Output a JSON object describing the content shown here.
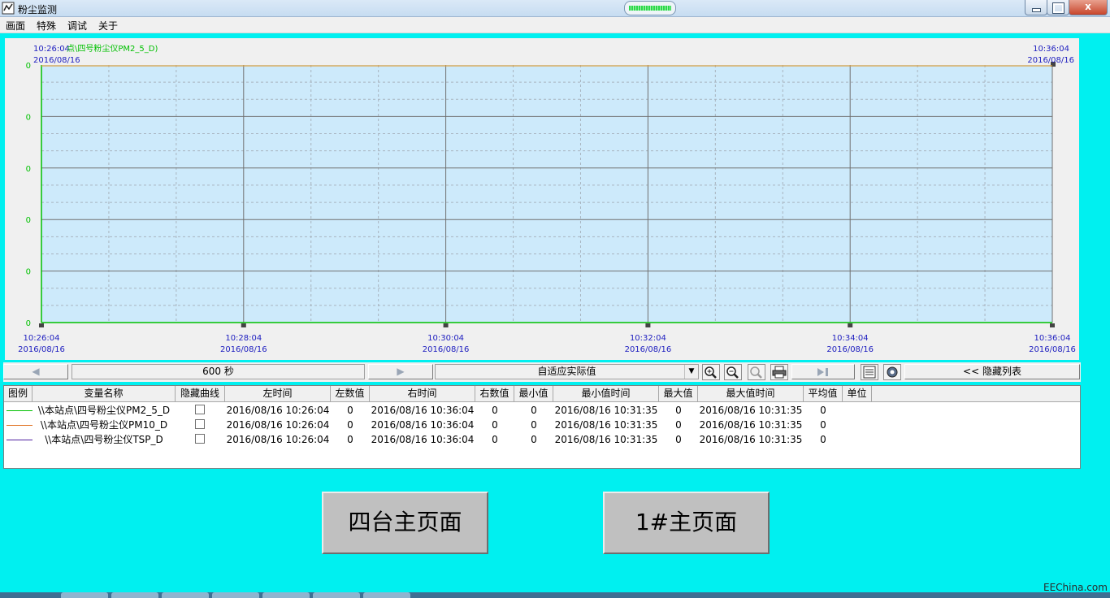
{
  "window": {
    "title": "粉尘监测",
    "close_label": "x"
  },
  "menu": [
    "画面",
    "特殊",
    "调试",
    "关于"
  ],
  "chart": {
    "header_left_time": "10:26:04",
    "header_left_date": "2016/08/16",
    "header_series": "点\\四号粉尘仪PM2_5_D)",
    "header_right_time": "10:36:04",
    "header_right_date": "2016/08/16",
    "y_tick_labels": [
      "0",
      "0",
      "0",
      "0",
      "0",
      "0"
    ],
    "x_ticks": [
      {
        "time": "10:26:04",
        "date": "2016/08/16"
      },
      {
        "time": "10:28:04",
        "date": "2016/08/16"
      },
      {
        "time": "10:30:04",
        "date": "2016/08/16"
      },
      {
        "time": "10:32:04",
        "date": "2016/08/16"
      },
      {
        "time": "10:34:04",
        "date": "2016/08/16"
      },
      {
        "time": "10:36:04",
        "date": "2016/08/16"
      }
    ],
    "colors": {
      "plot_bg": "#cdeafb",
      "axis_green": "#00c000",
      "label_blue": "#2020c0",
      "header_green": "#00c000",
      "trace_orange": "#e0a040"
    }
  },
  "chart_data": {
    "type": "line",
    "x": [
      "10:26:04",
      "10:28:04",
      "10:30:04",
      "10:32:04",
      "10:34:04",
      "10:36:04"
    ],
    "series": [
      {
        "name": "\\\\本站点\\四号粉尘仪PM2_5_D",
        "values": [
          0,
          0,
          0,
          0,
          0,
          0
        ],
        "color": "#00c000"
      },
      {
        "name": "\\\\本站点\\四号粉尘仪PM10_D",
        "values": [
          0,
          0,
          0,
          0,
          0,
          0
        ],
        "color": "#e07020"
      },
      {
        "name": "\\\\本站点\\四号粉尘仪TSP_D",
        "values": [
          0,
          0,
          0,
          0,
          0,
          0
        ],
        "color": "#5020a0"
      }
    ],
    "ylim": [
      0,
      0
    ],
    "grid": true
  },
  "toolbar": {
    "prev_glyph": "◀",
    "duration": "600 秒",
    "next_glyph": "▶",
    "mode": "自适应实际值",
    "combo_glyph": "▼",
    "hide_list": "<<  隐藏列表"
  },
  "table": {
    "headers": [
      "图例",
      "变量名称",
      "隐藏曲线",
      "左时间",
      "左数值",
      "右时间",
      "右数值",
      "最小值",
      "最小值时间",
      "最大值",
      "最大值时间",
      "平均值",
      "单位"
    ],
    "rows": [
      {
        "color": "#00c000",
        "name": "\\\\本站点\\四号粉尘仪PM2_5_D",
        "left_time": "2016/08/16 10:26:04",
        "left_value": "0",
        "right_time": "2016/08/16 10:36:04",
        "right_value": "0",
        "min": "0",
        "min_time": "2016/08/16 10:31:35",
        "max": "0",
        "max_time": "2016/08/16 10:31:35",
        "avg": "0"
      },
      {
        "color": "#e07020",
        "name": "\\\\本站点\\四号粉尘仪PM10_D",
        "left_time": "2016/08/16 10:26:04",
        "left_value": "0",
        "right_time": "2016/08/16 10:36:04",
        "right_value": "0",
        "min": "0",
        "min_time": "2016/08/16 10:31:35",
        "max": "0",
        "max_time": "2016/08/16 10:31:35",
        "avg": "0"
      },
      {
        "color": "#5020a0",
        "name": "\\\\本站点\\四号粉尘仪TSP_D",
        "left_time": "2016/08/16 10:26:04",
        "left_value": "0",
        "right_time": "2016/08/16 10:36:04",
        "right_value": "0",
        "min": "0",
        "min_time": "2016/08/16 10:31:35",
        "max": "0",
        "max_time": "2016/08/16 10:31:35",
        "avg": "0"
      }
    ]
  },
  "buttons": {
    "four_main": "四台主页面",
    "one_main": "1#主页面"
  },
  "watermark": "EEChina.com"
}
